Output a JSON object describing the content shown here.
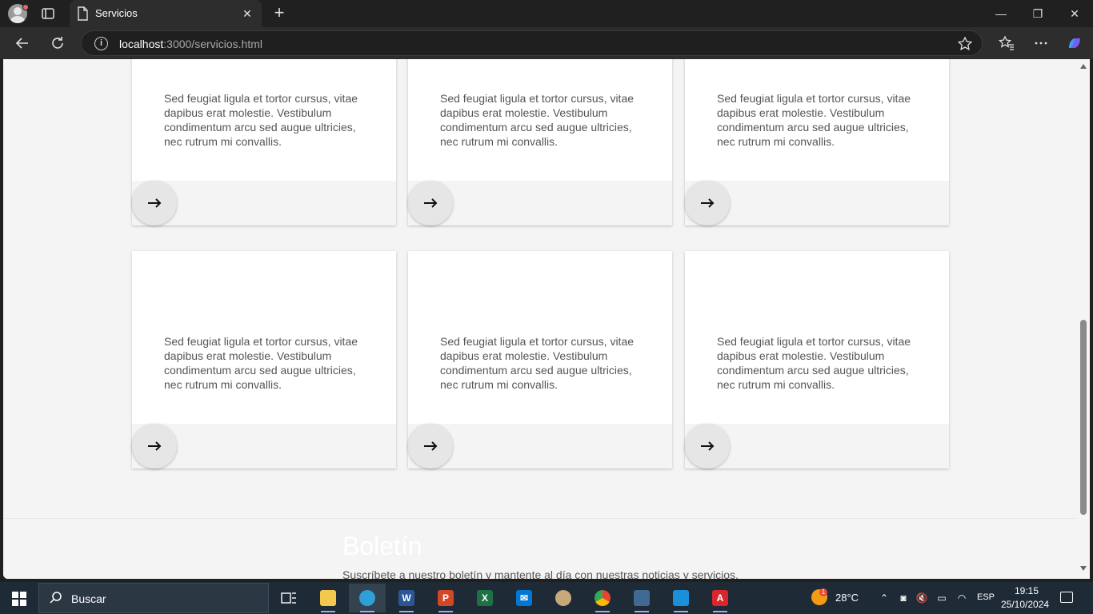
{
  "browser": {
    "tab_title": "Servicios",
    "url_host": "localhost",
    "url_rest": ":3000/servicios.html"
  },
  "cards": [
    {
      "text": "Sed feugiat ligula et tortor cursus, vitae dapibus erat molestie. Vestibulum condimentum arcu sed augue ultricies, nec rutrum mi convallis.",
      "button": "→"
    },
    {
      "text": "Sed feugiat ligula et tortor cursus, vitae dapibus erat molestie. Vestibulum condimentum arcu sed augue ultricies, nec rutrum mi convallis.",
      "button": "→"
    },
    {
      "text": "Sed feugiat ligula et tortor cursus, vitae dapibus erat molestie. Vestibulum condimentum arcu sed augue ultricies, nec rutrum mi convallis.",
      "button": "→"
    },
    {
      "text": "Sed feugiat ligula et tortor cursus, vitae dapibus erat molestie. Vestibulum condimentum arcu sed augue ultricies, nec rutrum mi convallis.",
      "button": "→"
    },
    {
      "text": "Sed feugiat ligula et tortor cursus, vitae dapibus erat molestie. Vestibulum condimentum arcu sed augue ultricies, nec rutrum mi convallis.",
      "button": "→"
    },
    {
      "text": "Sed feugiat ligula et tortor cursus, vitae dapibus erat molestie. Vestibulum condimentum arcu sed augue ultricies, nec rutrum mi convallis.",
      "button": "→"
    }
  ],
  "newsletter": {
    "title": "Boletín",
    "subtitle": "Suscríbete a nuestro boletín y mantente al día con nuestras noticias y servicios."
  },
  "taskbar": {
    "search_placeholder": "Buscar",
    "weather_temp": "28°C",
    "weather_badge": "1",
    "language": "ESP",
    "time": "19:15",
    "date": "25/10/2024",
    "apps": [
      "file-explorer",
      "edge",
      "word",
      "powerpoint",
      "excel",
      "mail",
      "paint",
      "chrome",
      "mysql-workbench",
      "vscode",
      "acrobat"
    ]
  },
  "colors": {
    "page_bg": "#f4f4f4",
    "card_bg": "#ffffff",
    "card_text": "#555555",
    "taskbar_bg": "#1e2a36"
  }
}
